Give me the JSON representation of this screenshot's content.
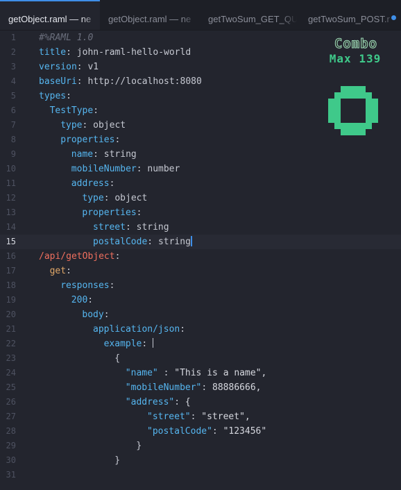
{
  "tabs": [
    {
      "label": "getObject.raml — ne",
      "active": true,
      "modified": false
    },
    {
      "label": "getObject.raml — ne",
      "active": false,
      "modified": false
    },
    {
      "label": "getTwoSum_GET_QU",
      "active": false,
      "modified": false
    },
    {
      "label": "getTwoSum_POST.r",
      "active": false,
      "modified": true
    }
  ],
  "editor": {
    "current_line": 15,
    "line_numbers": [
      "1",
      "2",
      "3",
      "4",
      "5",
      "6",
      "7",
      "8",
      "9",
      "10",
      "11",
      "12",
      "13",
      "14",
      "15",
      "16",
      "17",
      "18",
      "19",
      "20",
      "21",
      "22",
      "23",
      "24",
      "25",
      "26",
      "27",
      "28",
      "29",
      "30",
      "31"
    ],
    "lines": [
      {
        "indent": 0,
        "comment": "#%RAML 1.0"
      },
      {
        "indent": 0,
        "key": "title",
        "value": "john-raml-hello-world"
      },
      {
        "indent": 0,
        "key": "version",
        "value": "v1"
      },
      {
        "indent": 0,
        "key": "baseUri",
        "value": "http://localhost:8080"
      },
      {
        "indent": 0,
        "key": "types",
        "value": ""
      },
      {
        "indent": 2,
        "key": "TestType",
        "value": ""
      },
      {
        "indent": 4,
        "key": "type",
        "value": "object"
      },
      {
        "indent": 4,
        "key": "properties",
        "value": ""
      },
      {
        "indent": 6,
        "key": "name",
        "value": "string"
      },
      {
        "indent": 6,
        "key": "mobileNumber",
        "value": "number"
      },
      {
        "indent": 6,
        "key": "address",
        "value": ""
      },
      {
        "indent": 8,
        "key": "type",
        "value": "object"
      },
      {
        "indent": 8,
        "key": "properties",
        "value": ""
      },
      {
        "indent": 10,
        "key": "street",
        "value": "string"
      },
      {
        "indent": 10,
        "key": "postalCode",
        "value": "string",
        "caret": true
      },
      {
        "indent": 0,
        "route": "/api/getObject"
      },
      {
        "indent": 2,
        "method": "get"
      },
      {
        "indent": 4,
        "key": "responses",
        "value": ""
      },
      {
        "indent": 6,
        "key": "200",
        "value": ""
      },
      {
        "indent": 8,
        "key": "body",
        "value": ""
      },
      {
        "indent": 10,
        "key": "application/json",
        "value": ""
      },
      {
        "indent": 12,
        "key": "example",
        "value": "",
        "bar": true
      },
      {
        "indent": 14,
        "raw": "{"
      },
      {
        "indent": 16,
        "jkey": "\"name\"",
        "sep": " : ",
        "jval": "\"This is a name\","
      },
      {
        "indent": 16,
        "jkey": "\"mobileNumber\"",
        "sep": ": ",
        "jval": "88886666,"
      },
      {
        "indent": 16,
        "jkey": "\"address\"",
        "sep": ": ",
        "jval": "{"
      },
      {
        "indent": 20,
        "jkey": "\"street\"",
        "sep": ": ",
        "jval": "\"street\","
      },
      {
        "indent": 20,
        "jkey": "\"postalCode\"",
        "sep": ": ",
        "jval": "\"123456\""
      },
      {
        "indent": 18,
        "raw": "}"
      },
      {
        "indent": 14,
        "raw": "}"
      },
      {
        "indent": 0,
        "raw": ""
      }
    ]
  },
  "combo": {
    "title": "Combo",
    "max_label": "Max 139",
    "count": "0"
  },
  "colors": {
    "accent": "#3f8fe8",
    "key": "#56b6f0",
    "route": "#ef6f5e",
    "method": "#e2a868",
    "combo_green": "#3fc98a"
  }
}
